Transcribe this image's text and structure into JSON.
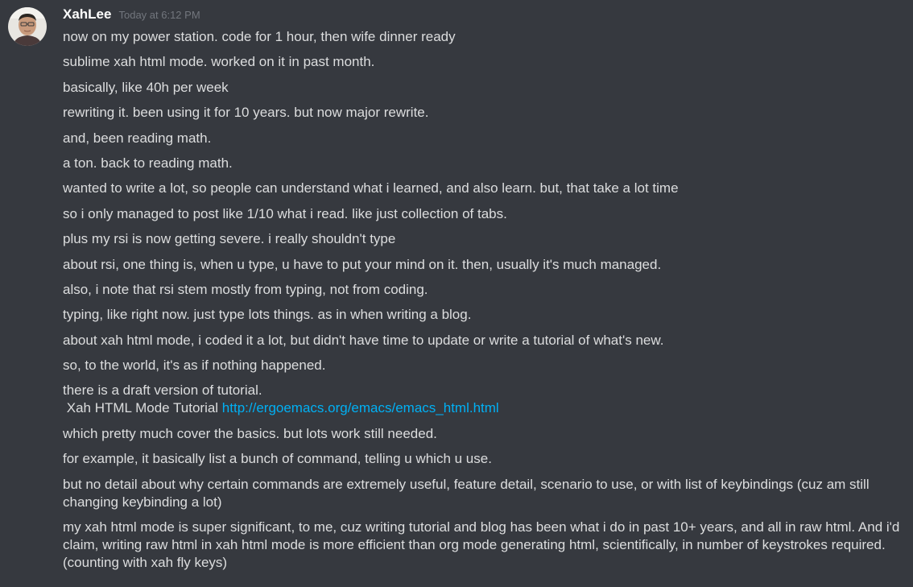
{
  "author": {
    "username": "XahLee",
    "timestamp": "Today at 6:12 PM",
    "avatar_icon": "user-avatar"
  },
  "colors": {
    "background": "#36393f",
    "text": "#dcddde",
    "username": "#ffffff",
    "timestamp": "#72767d",
    "link": "#00b0f4"
  },
  "messages": [
    "now on my power station. code for 1 hour, then wife dinner ready",
    "sublime xah html mode. worked on it in past month.",
    "basically, like 40h per week",
    "rewriting it. been using it for 10 years. but now major rewrite.",
    "and, been reading math.",
    "a ton. back to reading math.",
    "wanted to write a lot, so people can understand what i learned, and also learn. but, that take a lot time",
    "so i only managed to post like 1/10 what i read. like just collection of tabs.",
    "plus my rsi is now getting severe. i really shouldn't type",
    "about rsi, one thing is, when u type, u have to put your mind on it. then, usually it's much managed.",
    "also, i note that rsi stem mostly from typing, not from coding.",
    "typing, like right now. just type lots things. as in when writing a blog.",
    "about xah html mode, i coded it a lot, but didn't have time to update or write a tutorial of what's new.",
    "so, to the world, it's as if nothing happened.",
    "there is a draft version of tutorial."
  ],
  "tutorial_link": {
    "prefix": " Xah HTML Mode Tutorial ",
    "url": "http://ergoemacs.org/emacs/emacs_html.html"
  },
  "messages_after": [
    "which pretty much cover the basics. but lots work still needed.",
    "for example, it basically list a bunch of command, telling u which u use.",
    "but no detail about why certain commands are extremely useful, feature detail, scenario to use, or with list of keybindings (cuz am still changing keybinding a lot)",
    "my xah html mode is super significant, to me, cuz writing tutorial and blog has been what i do in past 10+ years, and all in raw html. And i'd claim, writing raw html in xah html mode is more efficient than org mode generating html, scientifically, in number of keystrokes required. (counting with xah fly keys)"
  ]
}
